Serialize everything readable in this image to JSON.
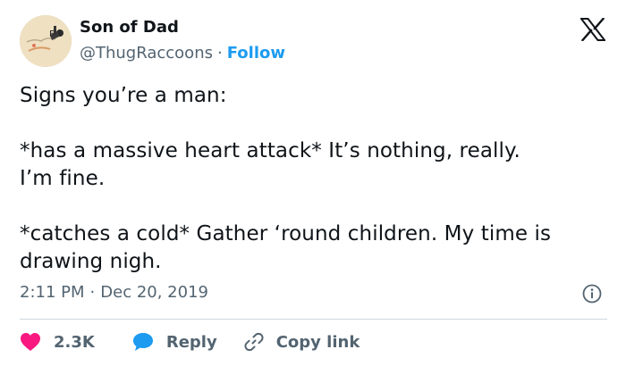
{
  "tweet": {
    "author": {
      "display_name": "Son of Dad",
      "handle": "@ThugRaccoons",
      "separator": "·",
      "follow_label": "Follow"
    },
    "text": [
      "Signs you’re a man:",
      "*has a massive heart attack* It’s nothing, really.\nI’m fine.",
      "*catches a cold* Gather ‘round children. My time is\ndrawing nigh."
    ],
    "time": "2:11 PM",
    "time_separator": "·",
    "date": "Dec 20, 2019"
  },
  "actions": {
    "like_count": "2.3K",
    "reply_label": "Reply",
    "copy_link_label": "Copy link"
  },
  "icons": {
    "brand": "x-logo-icon",
    "info": "info-icon",
    "like": "heart-icon",
    "reply": "speech-bubble-icon",
    "copy_link": "link-icon"
  },
  "colors": {
    "like": "#f91880",
    "reply": "#1d9bf0",
    "link": "#1d9bf0",
    "text": "#0f1419",
    "muted": "#536471",
    "divider": "#cfd9de"
  }
}
